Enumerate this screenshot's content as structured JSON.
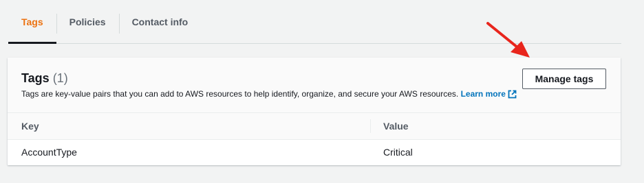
{
  "tabs": [
    {
      "label": "Tags",
      "active": true
    },
    {
      "label": "Policies",
      "active": false
    },
    {
      "label": "Contact info",
      "active": false
    }
  ],
  "panel": {
    "title": "Tags",
    "count": "(1)",
    "description": "Tags are key-value pairs that you can add to AWS resources to help identify, organize, and secure your AWS resources.",
    "learn_more": "Learn more",
    "manage_button": "Manage tags"
  },
  "table": {
    "columns": [
      "Key",
      "Value"
    ],
    "rows": [
      {
        "key": "AccountType",
        "value": "Critical"
      }
    ]
  },
  "colors": {
    "accent": "#ec7211",
    "link": "#0073bb",
    "annotation_arrow": "#e8251c"
  },
  "icons": {
    "external_link": "external-link-icon",
    "annotation": "red-arrow-annotation-icon"
  }
}
